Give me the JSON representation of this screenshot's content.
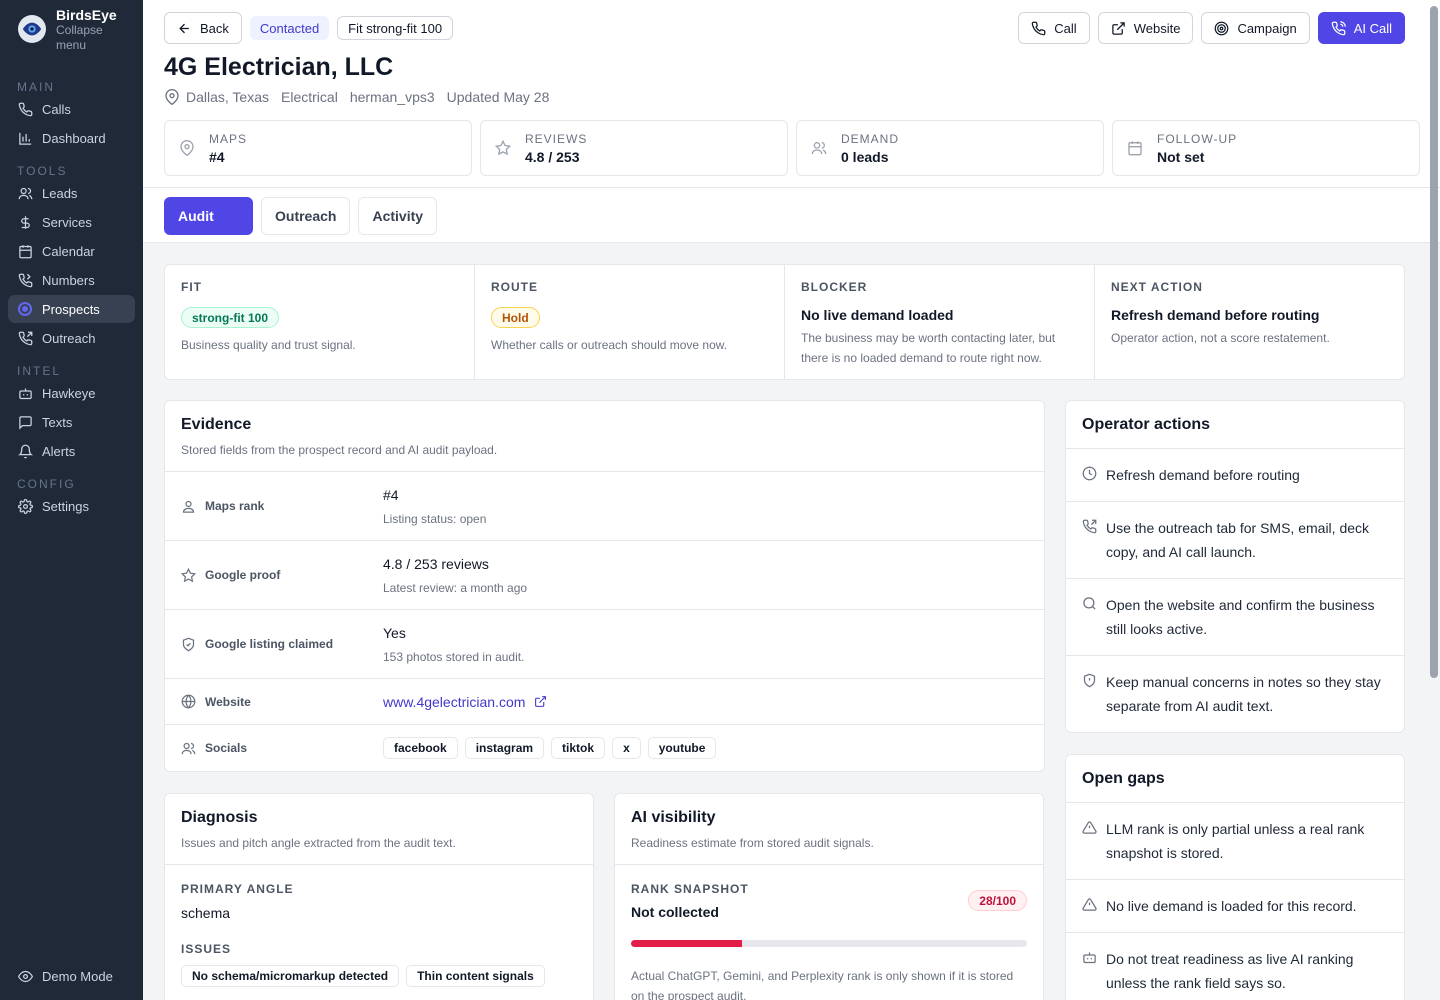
{
  "sidebar": {
    "brand": "BirdsEye",
    "collapse": "Collapse menu",
    "sections": {
      "main": "MAIN",
      "tools": "TOOLS",
      "intel": "INTEL",
      "config": "CONFIG"
    },
    "items": {
      "calls": "Calls",
      "dashboard": "Dashboard",
      "leads": "Leads",
      "services": "Services",
      "calendar": "Calendar",
      "numbers": "Numbers",
      "prospects": "Prospects",
      "outreach": "Outreach",
      "hawkeye": "Hawkeye",
      "texts": "Texts",
      "alerts": "Alerts",
      "settings": "Settings"
    },
    "demo_mode": "Demo Mode"
  },
  "topbar": {
    "back": "Back",
    "status": "Contacted",
    "fit_chip": "Fit strong-fit 100",
    "call": "Call",
    "website": "Website",
    "campaign": "Campaign",
    "ai_call": "AI Call"
  },
  "prospect": {
    "name": "4G Electrician, LLC",
    "location": "Dallas, Texas",
    "category": "Electrical",
    "owner": "herman_vps3",
    "updated": "Updated May 28"
  },
  "stats": {
    "maps_label": "MAPS",
    "maps_value": "#4",
    "reviews_label": "REVIEWS",
    "reviews_value": "4.8 / 253",
    "demand_label": "DEMAND",
    "demand_value": "0 leads",
    "followup_label": "FOLLOW-UP",
    "followup_value": "Not set"
  },
  "tabs": {
    "audit": "Audit",
    "outreach": "Outreach",
    "activity": "Activity"
  },
  "summary": {
    "fit_label": "FIT",
    "fit_badge": "strong-fit 100",
    "fit_desc": "Business quality and trust signal.",
    "route_label": "ROUTE",
    "route_badge": "Hold",
    "route_desc": "Whether calls or outreach should move now.",
    "blocker_label": "BLOCKER",
    "blocker_head": "No live demand loaded",
    "blocker_desc": "The business may be worth contacting later, but there is no loaded demand to route right now.",
    "next_label": "NEXT ACTION",
    "next_head": "Refresh demand before routing",
    "next_desc": "Operator action, not a score restatement."
  },
  "evidence": {
    "title": "Evidence",
    "subtitle": "Stored fields from the prospect record and AI audit payload.",
    "maps_key": "Maps rank",
    "maps_val": "#4",
    "maps_sub": "Listing status: open",
    "google_key": "Google proof",
    "google_val": "4.8 / 253 reviews",
    "google_sub": "Latest review: a month ago",
    "claimed_key": "Google listing claimed",
    "claimed_val": "Yes",
    "claimed_sub": "153 photos stored in audit.",
    "website_key": "Website",
    "website_val": "www.4gelectrician.com",
    "socials_key": "Socials",
    "socials": [
      "facebook",
      "instagram",
      "tiktok",
      "x",
      "youtube"
    ]
  },
  "operator": {
    "title": "Operator actions",
    "items": [
      "Refresh demand before routing",
      "Use the outreach tab for SMS, email, deck copy, and AI call launch.",
      "Open the website and confirm the business still looks active.",
      "Keep manual concerns in notes so they stay separate from AI audit text."
    ]
  },
  "gaps": {
    "title": "Open gaps",
    "items": [
      "LLM rank is only partial unless a real rank snapshot is stored.",
      "No live demand is loaded for this record.",
      "Do not treat readiness as live AI ranking unless the rank field says so."
    ]
  },
  "diagnosis": {
    "title": "Diagnosis",
    "subtitle": "Issues and pitch angle extracted from the audit text.",
    "angle_label": "PRIMARY ANGLE",
    "angle_val": "schema",
    "issues_label": "ISSUES",
    "issues": [
      "No schema/micromarkup detected",
      "Thin content signals"
    ]
  },
  "ai_visibility": {
    "title": "AI visibility",
    "subtitle": "Readiness estimate from stored audit signals.",
    "rank_label": "RANK SNAPSHOT",
    "rank_val": "Not collected",
    "score_badge": "28/100",
    "score": 28,
    "note": "Actual ChatGPT, Gemini, and Perplexity rank is only shown if it is stored on the prospect audit."
  },
  "colors": {
    "accent": "#4f46e5",
    "sidebar": "#1f2937",
    "danger": "#e11d48"
  }
}
